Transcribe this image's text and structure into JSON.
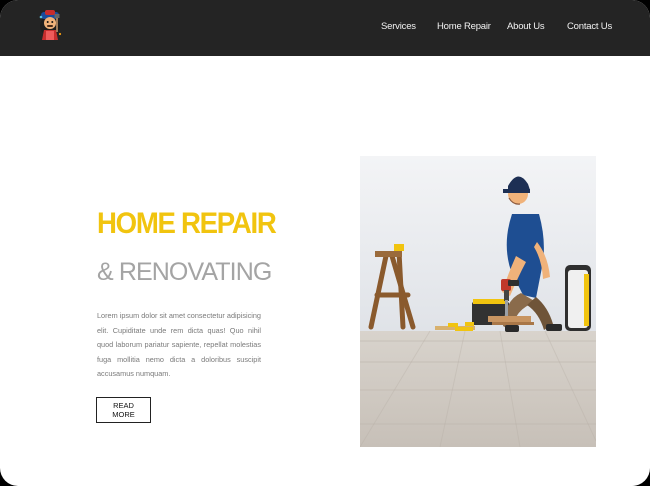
{
  "header": {
    "logo_icon": "handyman-mascot-icon",
    "nav": [
      {
        "label": "Services"
      },
      {
        "label": "Home Repair"
      },
      {
        "label": "About Us"
      },
      {
        "label": "Contact Us"
      }
    ]
  },
  "hero": {
    "title": "HOME REPAIR",
    "subtitle": "& RENOVATING",
    "body": "Lorem ipsum dolor sit amet consectetur adipisicing elit. Cupiditate unde rem dicta quas! Quo nihil quod laborum pariatur sapiente, repellat molestias fuga mollitia nemo dicta a doloribus suscipit accusamus numquam.",
    "button_label": "READ MORE",
    "image_icon": "worker-drilling-floor-photo"
  },
  "colors": {
    "accent": "#f1c40f",
    "nav_bg": "#242424",
    "subtitle": "#a4a4a4"
  }
}
